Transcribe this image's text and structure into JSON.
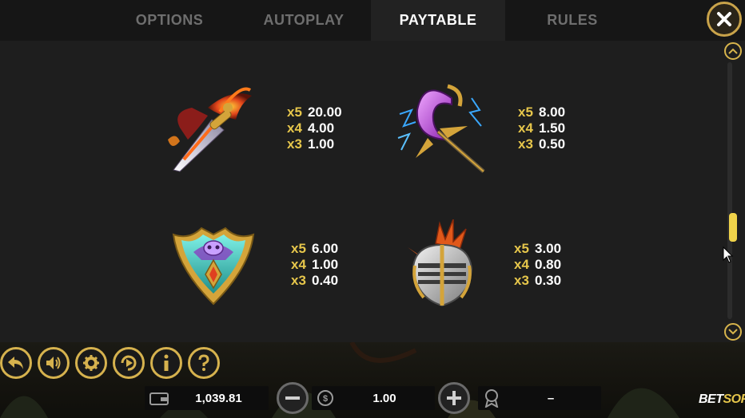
{
  "tabs": [
    {
      "label": "OPTIONS",
      "active": false
    },
    {
      "label": "AUTOPLAY",
      "active": false
    },
    {
      "label": "PAYTABLE",
      "active": true
    },
    {
      "label": "RULES",
      "active": false
    }
  ],
  "close_icon": "close-icon",
  "paytable": [
    {
      "symbol": "flaming-sword-symbol",
      "pays": [
        {
          "mult": "x5",
          "value": "20.00"
        },
        {
          "mult": "x4",
          "value": "4.00"
        },
        {
          "mult": "x3",
          "value": "1.00"
        }
      ]
    },
    {
      "symbol": "lightning-staff-symbol",
      "pays": [
        {
          "mult": "x5",
          "value": "8.00"
        },
        {
          "mult": "x4",
          "value": "1.50"
        },
        {
          "mult": "x3",
          "value": "0.50"
        }
      ]
    },
    {
      "symbol": "shield-symbol",
      "pays": [
        {
          "mult": "x5",
          "value": "6.00"
        },
        {
          "mult": "x4",
          "value": "1.00"
        },
        {
          "mult": "x3",
          "value": "0.40"
        }
      ]
    },
    {
      "symbol": "helmet-symbol",
      "pays": [
        {
          "mult": "x5",
          "value": "3.00"
        },
        {
          "mult": "x4",
          "value": "0.80"
        },
        {
          "mult": "x3",
          "value": "0.30"
        }
      ]
    }
  ],
  "scroll_position": 0.66,
  "bottom_bar": {
    "balance": "1,039.81",
    "bet": "1.00",
    "win": "–",
    "controls": [
      "back-icon",
      "sound-icon",
      "settings-icon",
      "autoplay-icon",
      "info-icon",
      "help-icon"
    ]
  },
  "brand": {
    "bet": "BET",
    "soft": "SOFT"
  },
  "colors": {
    "accent": "#d6b24e",
    "multiplier": "#e6c64b",
    "thumb": "#f0d34a"
  }
}
